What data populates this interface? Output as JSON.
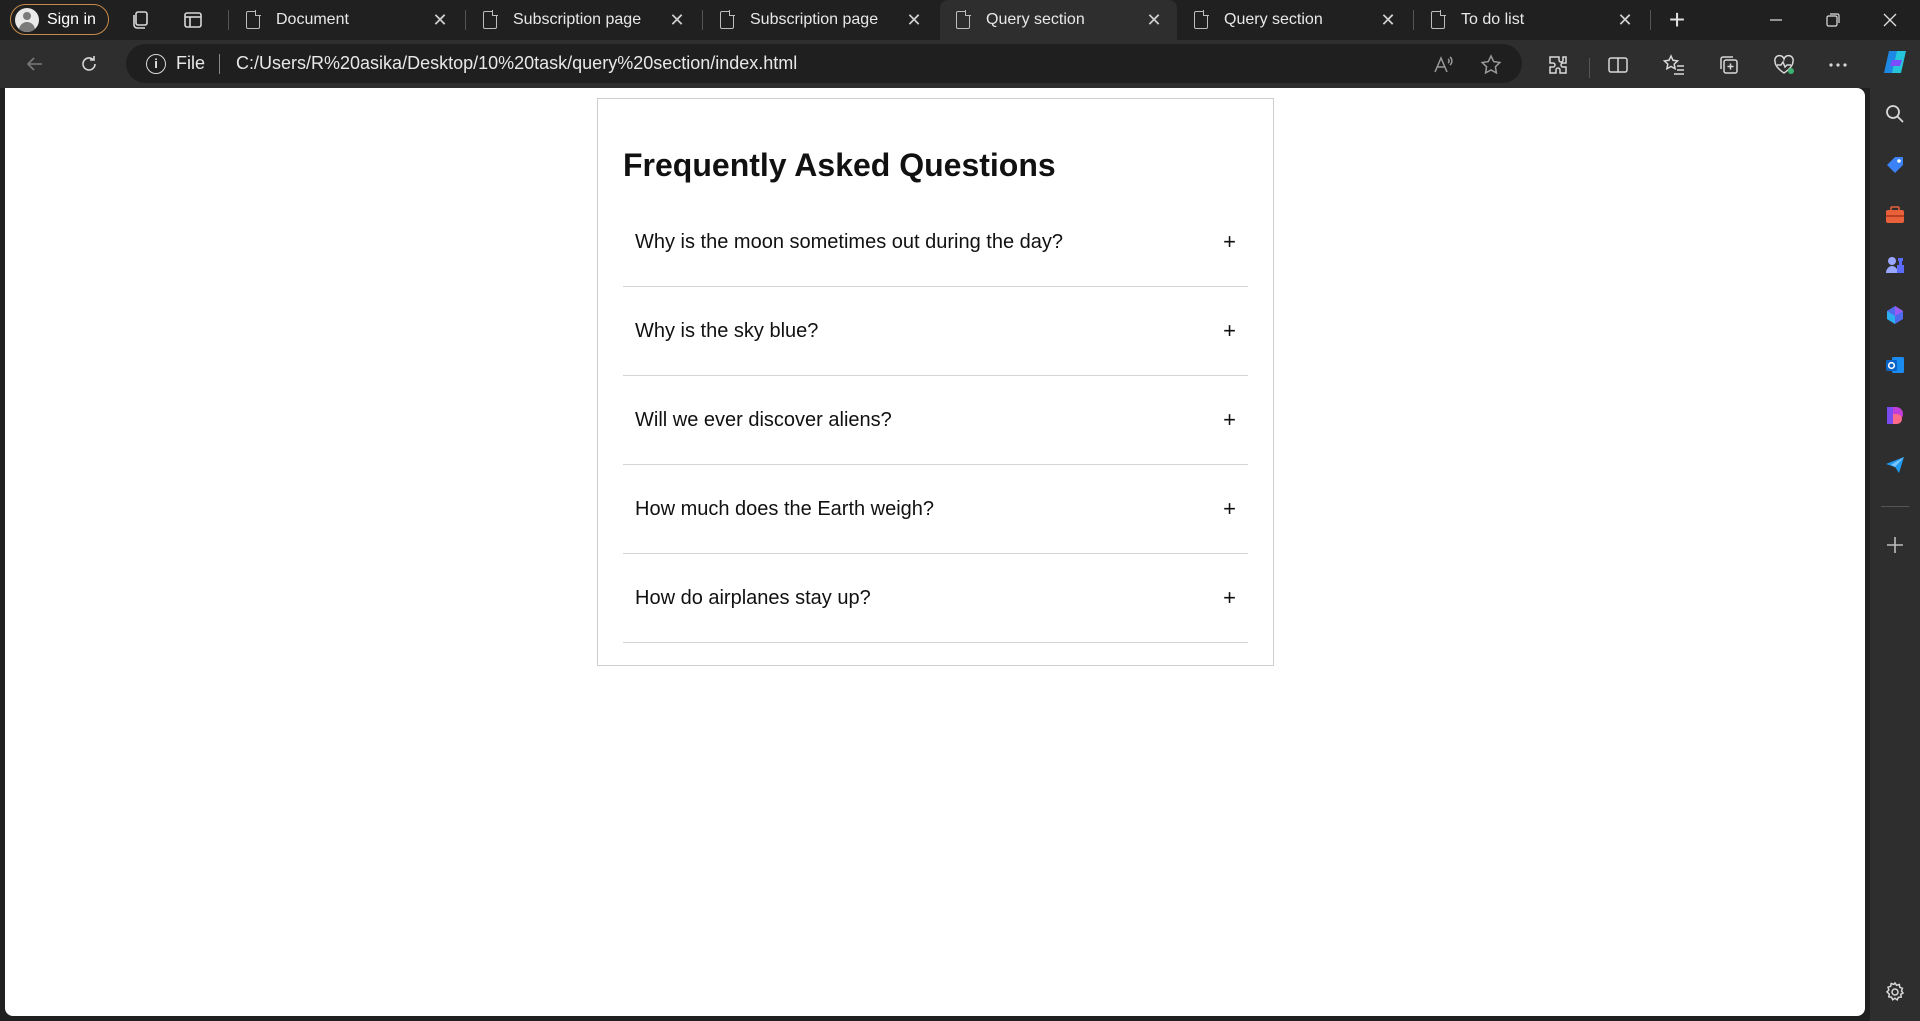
{
  "tabstrip": {
    "signin_label": "Sign in",
    "tabs": [
      {
        "label": "Document",
        "active": false
      },
      {
        "label": "Subscription page",
        "active": false
      },
      {
        "label": "Subscription page",
        "active": false
      },
      {
        "label": "Query section",
        "active": true
      },
      {
        "label": "Query section",
        "active": false
      },
      {
        "label": "To do list",
        "active": false
      }
    ],
    "close_glyph": "✕",
    "new_tab_glyph": "+"
  },
  "toolbar": {
    "scheme_label": "File",
    "url": "C:/Users/R%20asika/Desktop/10%20task/query%20section/index.html"
  },
  "faq": {
    "title": "Frequently Asked Questions",
    "toggle_glyph": "+",
    "questions": [
      "Why is the moon sometimes out during the day?",
      "Why is the sky blue?",
      "Will we ever discover aliens?",
      "How much does the Earth weigh?",
      "How do airplanes stay up?"
    ]
  },
  "colors": {
    "chrome_dark": "#202020",
    "toolbar": "#2e2e2e",
    "signin_border": "#c78a4a",
    "page_bg": "#ffffff"
  }
}
